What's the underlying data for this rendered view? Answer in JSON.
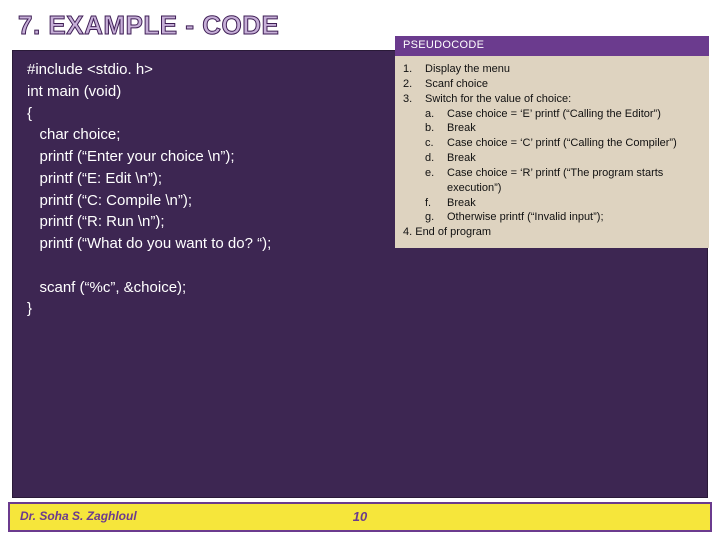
{
  "heading": "7. EXAMPLE - CODE",
  "code": "#include <stdio. h>\nint main (void)\n{\n   char choice;\n   printf (“Enter your choice \\n”);\n   printf (“E: Edit \\n”);\n   printf (“C: Compile \\n”);\n   printf (“R: Run \\n”);\n   printf (“What do you want to do? “);\n\n   scanf (“%c”, &choice);\n}",
  "pseudo": {
    "title": "PSEUDOCODE",
    "items": [
      {
        "n": "1.",
        "t": "Display the menu"
      },
      {
        "n": "2.",
        "t": "Scanf choice"
      },
      {
        "n": "3.",
        "t": "Switch for the value of choice:"
      }
    ],
    "sub": [
      {
        "n": "a.",
        "t": "Case choice = ‘E’ printf (“Calling the Editor”)"
      },
      {
        "n": "b.",
        "t": "Break"
      },
      {
        "n": "c.",
        "t": "Case choice = ‘C’ printf (“Calling the Compiler”)"
      },
      {
        "n": "d.",
        "t": "Break"
      },
      {
        "n": "e.",
        "t": "Case choice = ‘R’ printf (“The program starts execution”)"
      },
      {
        "n": "f.",
        "t": "Break"
      },
      {
        "n": "g.",
        "t": "Otherwise printf (“Invalid input”);"
      }
    ],
    "end": "4. End of program"
  },
  "footer": {
    "author": "Dr. Soha S. Zaghloul",
    "page": "10"
  }
}
